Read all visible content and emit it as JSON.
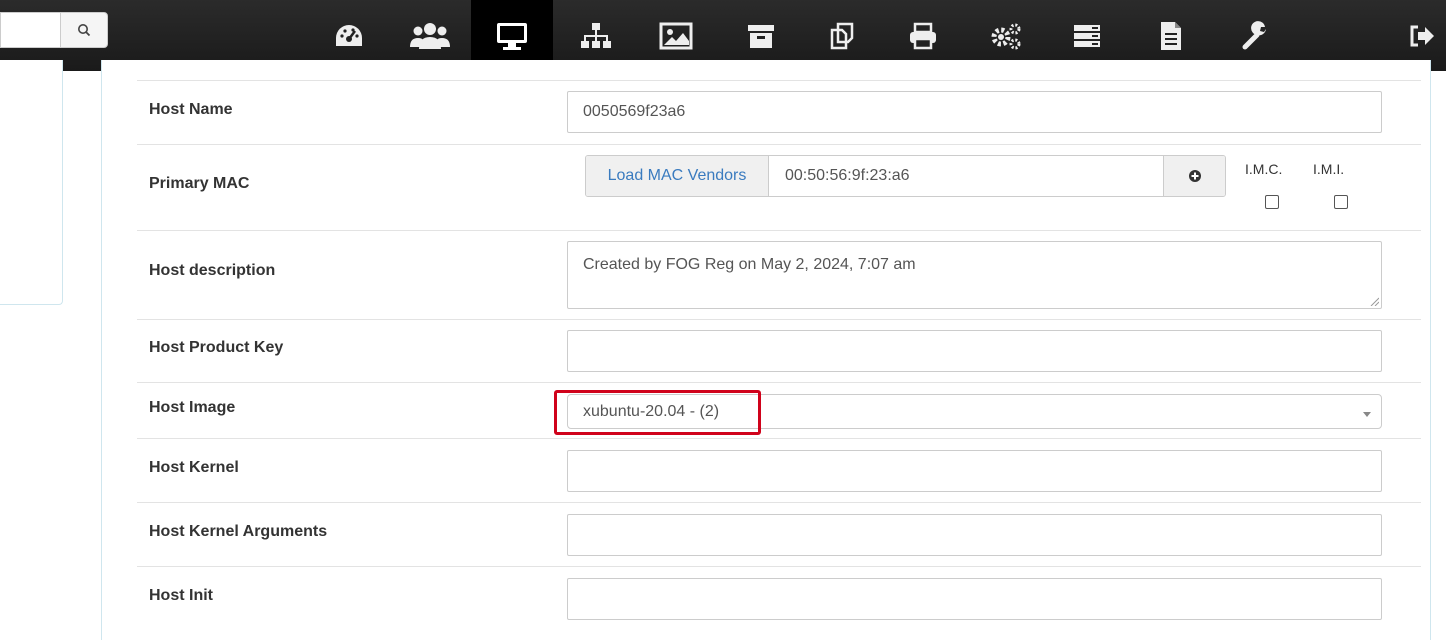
{
  "nav": {
    "icons": [
      "dashboard-icon",
      "users-icon",
      "hosts-icon",
      "groups-icon",
      "images-icon",
      "storage-icon",
      "snapins-icon",
      "printers-icon",
      "services-icon",
      "plugins-icon",
      "reports-icon",
      "settings-icon",
      "logout-icon"
    ],
    "active": "hosts-icon"
  },
  "form": {
    "host_name": {
      "label": "Host Name",
      "value": "0050569f23a6"
    },
    "primary_mac": {
      "label": "Primary MAC",
      "load_vendors": "Load MAC Vendors",
      "value": "00:50:56:9f:23:a6",
      "imc_label": "I.M.C.",
      "imi_label": "I.M.I."
    },
    "description": {
      "label": "Host description",
      "value": "Created by FOG Reg on May 2, 2024, 7:07 am"
    },
    "product_key": {
      "label": "Host Product Key",
      "value": ""
    },
    "image": {
      "label": "Host Image",
      "value": "xubuntu-20.04 - (2)"
    },
    "kernel": {
      "label": "Host Kernel",
      "value": ""
    },
    "kernel_args": {
      "label": "Host Kernel Arguments",
      "value": ""
    },
    "init": {
      "label": "Host Init",
      "value": ""
    }
  },
  "colors": {
    "nav_bg": "#1f1f1f",
    "link_blue": "#3a7bbf",
    "highlight_red": "#d0021b"
  }
}
